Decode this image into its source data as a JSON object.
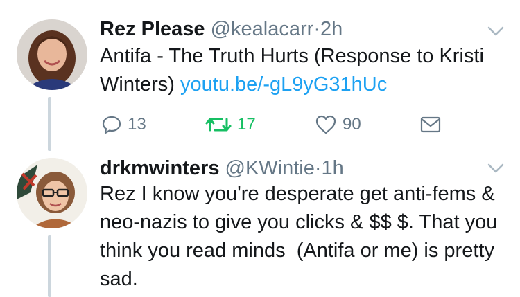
{
  "tweets": [
    {
      "name": "Rez Please",
      "handle": "@kealacarr",
      "separator": "·",
      "time": "2h",
      "text": "Antifa - The Truth Hurts (Response to Kristi Winters) ",
      "link": "youtu.be/-gL9yG31hUc",
      "actions": {
        "replies": "13",
        "retweets": "17",
        "likes": "90"
      },
      "retweet_color": "#17bf63"
    },
    {
      "name": "drkmwinters",
      "handle": "@KWintie",
      "separator": "·",
      "time": "1h",
      "text": "Rez I know you're desperate get anti-fems & neo-nazis to give you clicks & $$ $. That you think you read minds  (Antifa or me) is pretty sad."
    }
  ],
  "icons": {
    "reply": "reply-icon",
    "retweet": "retweet-icon",
    "like": "heart-icon",
    "dm": "envelope-icon",
    "caret": "chevron-down-icon"
  }
}
